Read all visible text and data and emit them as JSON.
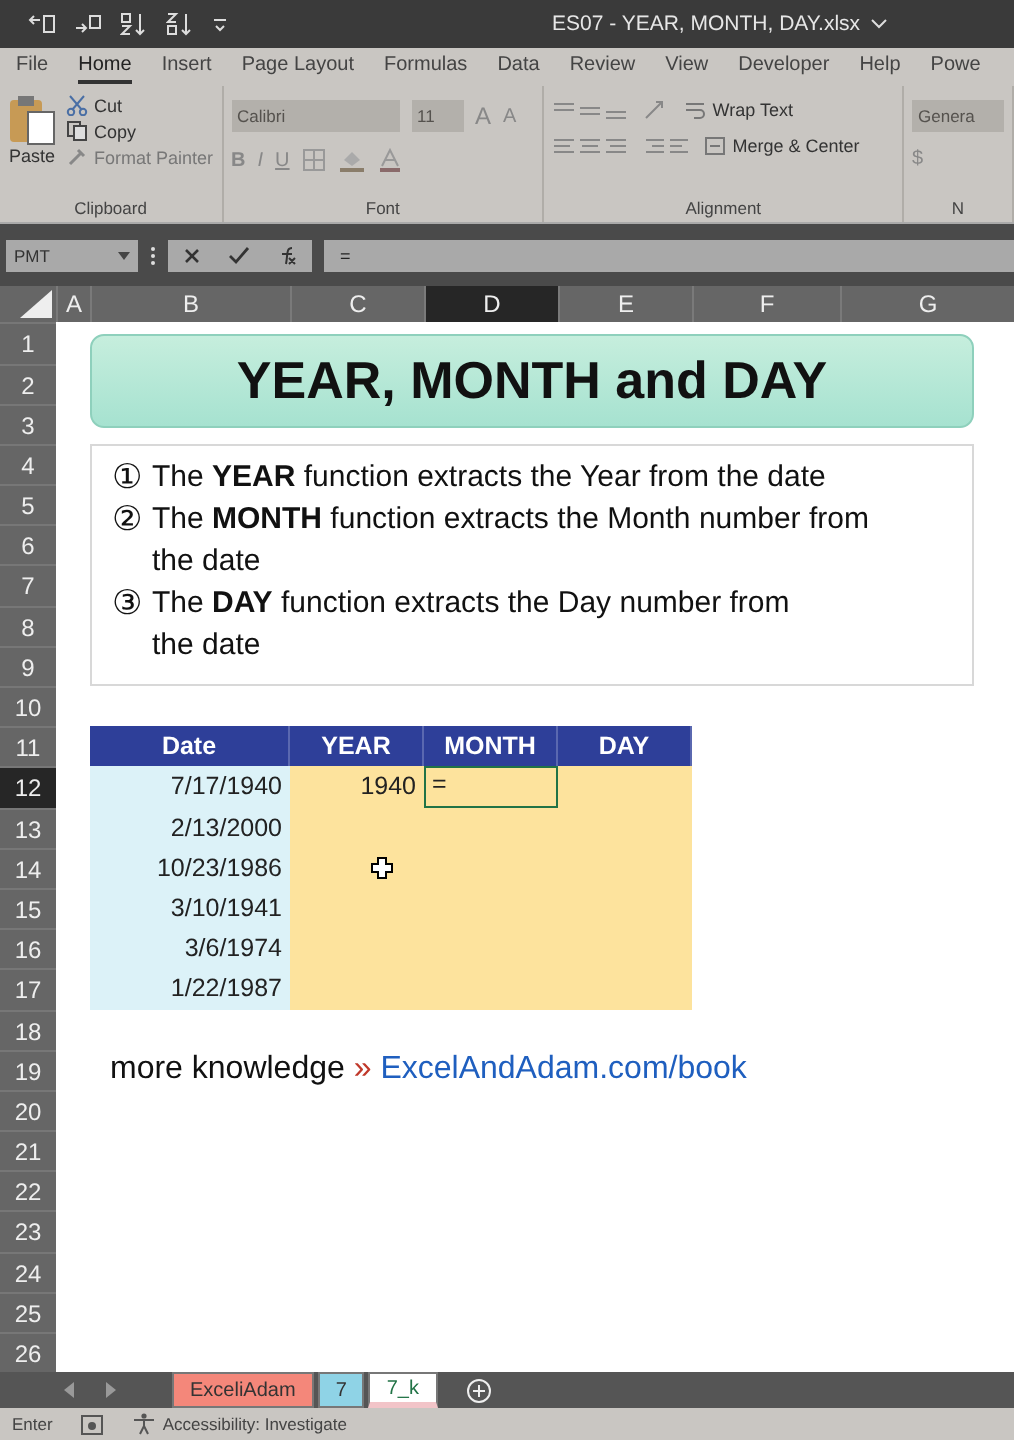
{
  "window": {
    "title": "ES07 - YEAR, MONTH, DAY.xlsx"
  },
  "ribbon_tabs": [
    {
      "label": "File",
      "selected": false
    },
    {
      "label": "Home",
      "selected": true
    },
    {
      "label": "Insert",
      "selected": false
    },
    {
      "label": "Page Layout",
      "selected": false
    },
    {
      "label": "Formulas",
      "selected": false
    },
    {
      "label": "Data",
      "selected": false
    },
    {
      "label": "Review",
      "selected": false
    },
    {
      "label": "View",
      "selected": false
    },
    {
      "label": "Developer",
      "selected": false
    },
    {
      "label": "Help",
      "selected": false
    },
    {
      "label": "Powe",
      "selected": false
    }
  ],
  "ribbon": {
    "clipboard": {
      "paste": "Paste",
      "cut": "Cut",
      "copy": "Copy",
      "format_painter": "Format Painter",
      "label": "Clipboard"
    },
    "font": {
      "name": "Calibri",
      "size": "11",
      "grow": "A",
      "shrink": "A",
      "bold": "B",
      "italic": "I",
      "underline": "U",
      "label": "Font"
    },
    "alignment": {
      "wrap_text": "Wrap Text",
      "merge_center": "Merge & Center",
      "label": "Alignment"
    },
    "number": {
      "format": "Genera",
      "currency": "$",
      "label": "N"
    }
  },
  "formula_bar": {
    "name_box": "PMT",
    "value": "="
  },
  "columns": [
    {
      "label": "A",
      "selected": false
    },
    {
      "label": "B",
      "selected": false
    },
    {
      "label": "C",
      "selected": false
    },
    {
      "label": "D",
      "selected": true
    },
    {
      "label": "E",
      "selected": false
    },
    {
      "label": "F",
      "selected": false
    },
    {
      "label": "G",
      "selected": false
    }
  ],
  "rows": [
    {
      "label": "1",
      "selected": false
    },
    {
      "label": "2",
      "selected": false
    },
    {
      "label": "3",
      "selected": false
    },
    {
      "label": "4",
      "selected": false
    },
    {
      "label": "5",
      "selected": false
    },
    {
      "label": "6",
      "selected": false
    },
    {
      "label": "7",
      "selected": false
    },
    {
      "label": "8",
      "selected": false
    },
    {
      "label": "9",
      "selected": false
    },
    {
      "label": "10",
      "selected": false
    },
    {
      "label": "11",
      "selected": false
    },
    {
      "label": "12",
      "selected": true
    },
    {
      "label": "13",
      "selected": false
    },
    {
      "label": "14",
      "selected": false
    },
    {
      "label": "15",
      "selected": false
    },
    {
      "label": "16",
      "selected": false
    },
    {
      "label": "17",
      "selected": false
    },
    {
      "label": "18",
      "selected": false
    },
    {
      "label": "19",
      "selected": false
    },
    {
      "label": "20",
      "selected": false
    },
    {
      "label": "21",
      "selected": false
    },
    {
      "label": "22",
      "selected": false
    },
    {
      "label": "23",
      "selected": false
    },
    {
      "label": "24",
      "selected": false
    },
    {
      "label": "25",
      "selected": false
    },
    {
      "label": "26",
      "selected": false
    }
  ],
  "banner": {
    "title": "YEAR, MONTH and DAY"
  },
  "notes": [
    {
      "marker": "①",
      "text": "The **YEAR** function extracts the Year from the date"
    },
    {
      "marker": "②",
      "text": "The **MONTH** function extracts the Month number from\nthe date"
    },
    {
      "marker": "③",
      "text": "The **DAY** function extracts the Day number from\nthe date"
    }
  ],
  "table": {
    "columns": [
      "Date",
      "YEAR",
      "MONTH",
      "DAY"
    ],
    "rows": [
      {
        "cells": [
          {
            "value": "7/17/1940",
            "selected": false
          },
          {
            "value": "1940",
            "selected": false
          },
          {
            "value": "=",
            "selected": true
          },
          {
            "selected": false
          }
        ]
      },
      {
        "cells": [
          {
            "value": "2/13/2000",
            "selected": false
          },
          {
            "selected": false
          },
          {
            "selected": false
          },
          {
            "selected": false
          }
        ]
      },
      {
        "cells": [
          {
            "value": "10/23/1986",
            "selected": false
          },
          {
            "selected": false
          },
          {
            "selected": false
          },
          {
            "selected": false
          }
        ]
      },
      {
        "cells": [
          {
            "value": "3/10/1941",
            "selected": false
          },
          {
            "selected": false
          },
          {
            "selected": false
          },
          {
            "selected": false
          }
        ]
      },
      {
        "cells": [
          {
            "value": "3/6/1974",
            "selected": false
          },
          {
            "selected": false
          },
          {
            "selected": false
          },
          {
            "selected": false
          }
        ]
      },
      {
        "cells": [
          {
            "value": "1/22/1987",
            "selected": false
          },
          {
            "selected": false
          },
          {
            "selected": false
          },
          {
            "selected": false
          }
        ]
      }
    ]
  },
  "promo": {
    "text": "more knowledge",
    "separator": "»",
    "link": "ExcelAndAdam.com/book"
  },
  "sheet_tabs": [
    {
      "label": "ExceliAdam",
      "color": "#f4877a",
      "selected": false
    },
    {
      "label": "7",
      "color": "#8fd3e6",
      "selected": false
    },
    {
      "label": "7_k",
      "color": "#f2c4c8",
      "selected": true
    }
  ],
  "status_bar": {
    "mode": "Enter",
    "accessibility": "Accessibility: Investigate"
  }
}
